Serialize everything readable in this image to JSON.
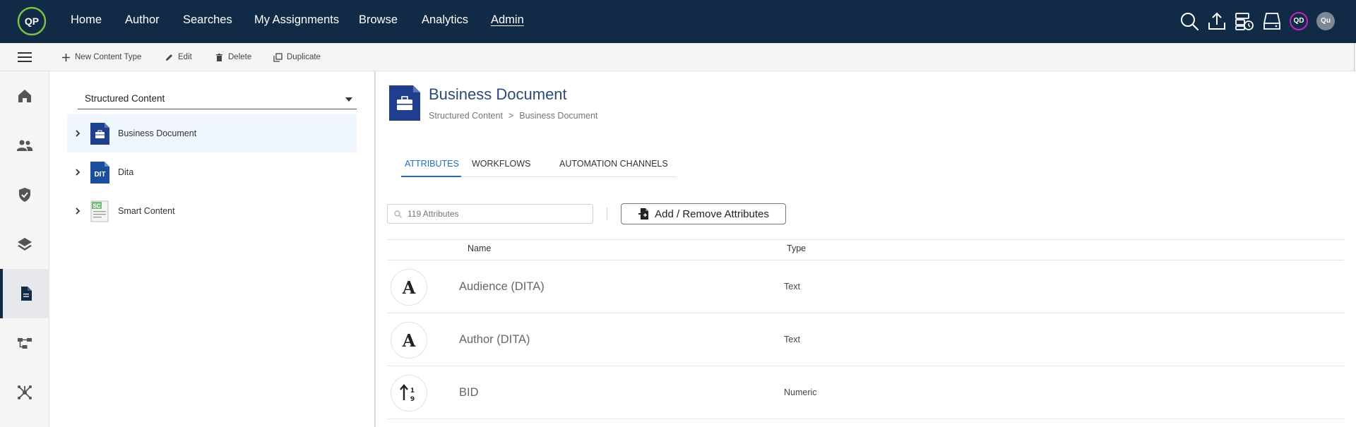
{
  "nav": {
    "logo_text": "QP",
    "items": [
      "Home",
      "Author",
      "Searches",
      "My Assignments",
      "Browse",
      "Analytics",
      "Admin"
    ],
    "active": "Admin",
    "avatars": [
      {
        "text": "QD",
        "color": "#c423c4"
      },
      {
        "text": "Qu",
        "color": "#7d8796"
      }
    ],
    "icons": [
      "search-icon",
      "upload-icon",
      "schedule-server-icon",
      "storage-icon"
    ]
  },
  "toolbar": {
    "new_label": "New Content Type",
    "edit_label": "Edit",
    "delete_label": "Delete",
    "duplicate_label": "Duplicate"
  },
  "rail": {
    "icons": [
      "home-icon",
      "users-icon",
      "shield-icon",
      "layers-icon",
      "document-icon",
      "workflow-icon",
      "hub-icon"
    ],
    "active_index": 4
  },
  "tree": {
    "selector_value": "Structured Content",
    "items": [
      {
        "label": "Business Document",
        "icon": "briefcase-icon",
        "selected": true
      },
      {
        "label": "Dita",
        "icon_text": "DIT",
        "selected": false
      },
      {
        "label": "Smart Content",
        "icon_text": "SC",
        "selected": false
      }
    ]
  },
  "main": {
    "title": "Business Document",
    "breadcrumb": [
      "Structured Content",
      ">",
      "Business Document"
    ],
    "tabs": [
      "ATTRIBUTES",
      "WORKFLOWS",
      "AUTOMATION CHANNELS"
    ],
    "active_tab": "ATTRIBUTES",
    "search_placeholder": "119 Attributes",
    "add_remove_label": "Add / Remove Attributes",
    "columns": {
      "name": "Name",
      "type": "Type"
    },
    "rows": [
      {
        "name": "Audience (DITA)",
        "type": "Text",
        "icon": "text-type-icon"
      },
      {
        "name": "Author (DITA)",
        "type": "Text",
        "icon": "text-type-icon"
      },
      {
        "name": "BID",
        "type": "Numeric",
        "icon": "numeric-type-icon"
      }
    ]
  },
  "colors": {
    "nav_bg": "#112a46",
    "accent": "#1f6fc1",
    "title": "#2b4a74",
    "logo_ring": "#7ac043"
  }
}
